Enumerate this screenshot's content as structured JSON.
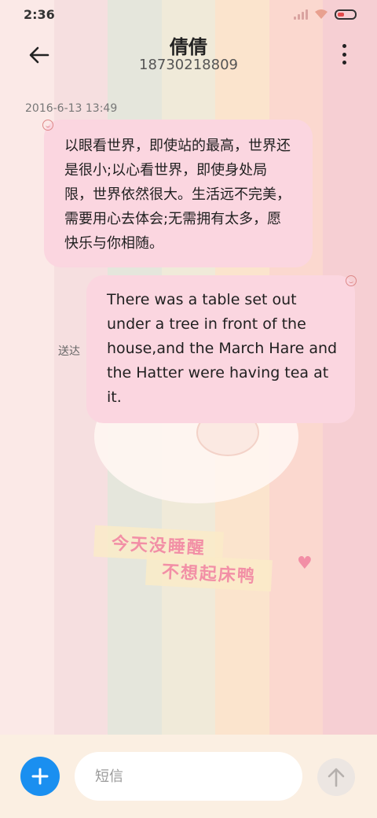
{
  "status_bar": {
    "time": "2:36"
  },
  "header": {
    "contact_name": "倩倩",
    "phone_number": "18730218809"
  },
  "conversation": {
    "timestamp": "2016-6-13 13:49",
    "messages": [
      {
        "direction": "incoming",
        "text": "以眼看世界，即使站的最高，世界还是很小;以心看世界，即使身处局限，世界依然很大。生活远不完美，需要用心去体会;无需拥有太多，愿快乐与你相随。"
      },
      {
        "direction": "outgoing",
        "text": "There was a table set out under a tree in front of the house,and the March Hare and the Hatter were having tea at it.",
        "status": "送达"
      }
    ]
  },
  "wallpaper": {
    "sticker_line1": "今天没睡醒",
    "sticker_line2": "不想起床鸭"
  },
  "composer": {
    "placeholder": "短信"
  },
  "colors": {
    "bubble": "#fbd6e0",
    "accent": "#1a8ff0",
    "sticker_text": "#f28fa6"
  },
  "icons": {
    "back": "arrow-left-icon",
    "more": "more-vertical-icon",
    "add": "plus-icon",
    "send": "arrow-up-icon"
  }
}
